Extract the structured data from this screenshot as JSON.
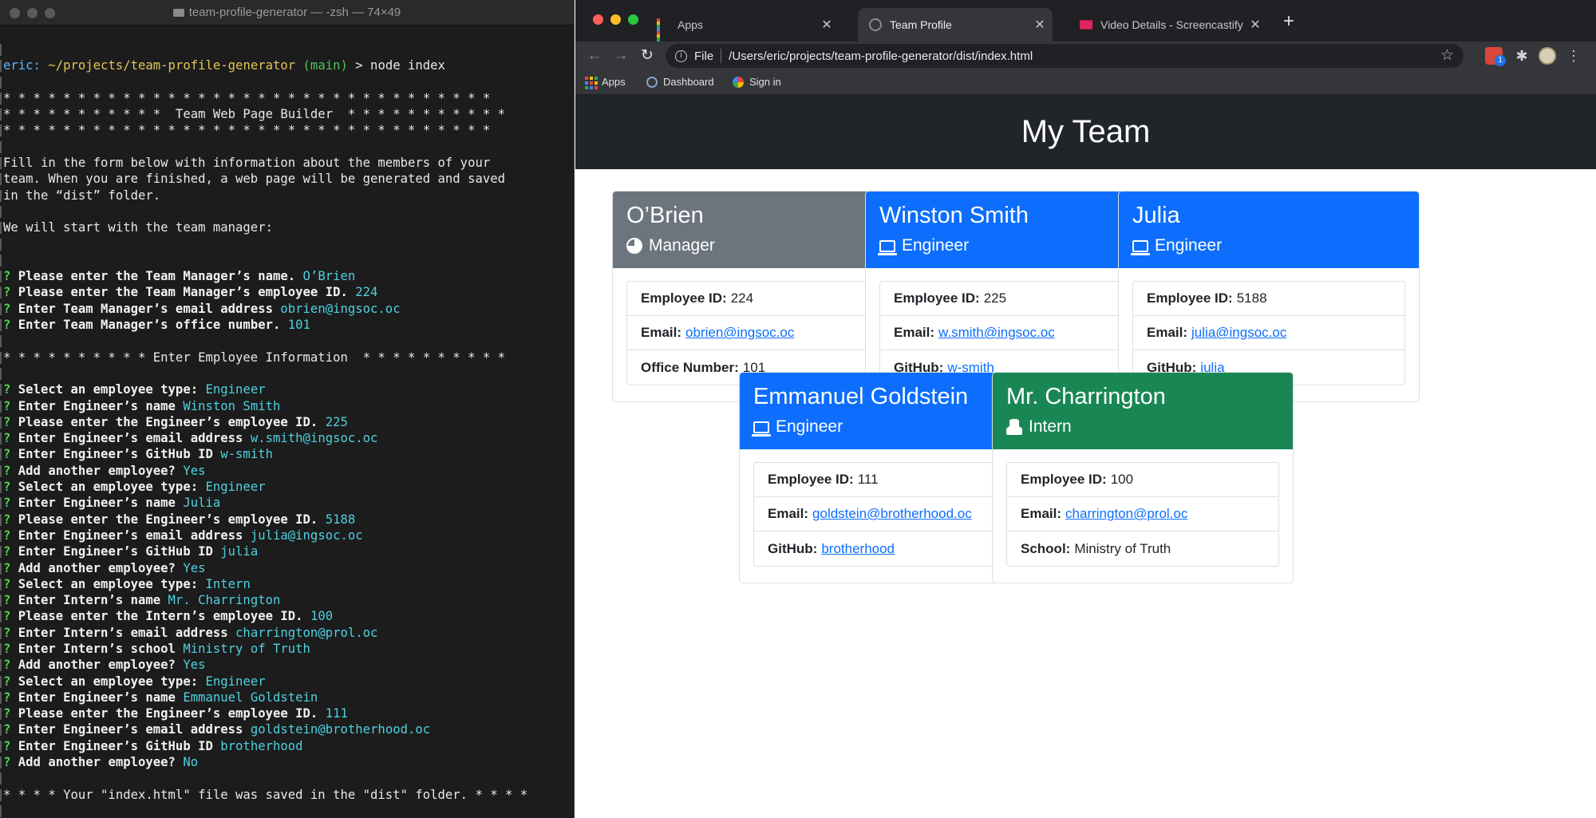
{
  "terminal": {
    "title": "team-profile-generator — -zsh — 74×49",
    "lines": [
      [],
      [
        {
          "t": "eric:",
          "c": "t-user"
        },
        {
          "t": " "
        },
        {
          "t": "~/projects/team-profile-generator",
          "c": "t-path"
        },
        {
          "t": " "
        },
        {
          "t": "(main)",
          "c": "t-branch"
        },
        {
          "t": " > node index"
        }
      ],
      [],
      [
        {
          "t": "* * * * * * * * * * * * * * * * * * * * * * * * * * * * * * * * *"
        }
      ],
      [
        {
          "t": "* * * * * * * * * * *  Team Web Page Builder  * * * * * * * * * * *"
        }
      ],
      [
        {
          "t": "* * * * * * * * * * * * * * * * * * * * * * * * * * * * * * * * *"
        }
      ],
      [],
      [
        {
          "t": "Fill in the form below with information about the members of your"
        }
      ],
      [
        {
          "t": "team. When you are finished, a web page will be generated and saved"
        }
      ],
      [
        {
          "t": "in the “dist” folder."
        }
      ],
      [],
      [
        {
          "t": "We will start with the team manager:"
        }
      ],
      [],
      [],
      [
        {
          "t": "? ",
          "c": "t-q"
        },
        {
          "t": "Please enter the Team Manager’s name. ",
          "c": "t-prompt"
        },
        {
          "t": "O’Brien",
          "c": "t-ans"
        }
      ],
      [
        {
          "t": "? ",
          "c": "t-q"
        },
        {
          "t": "Please enter the Team Manager’s employee ID. ",
          "c": "t-prompt"
        },
        {
          "t": "224",
          "c": "t-ans"
        }
      ],
      [
        {
          "t": "? ",
          "c": "t-q"
        },
        {
          "t": "Enter Team Manager’s email address ",
          "c": "t-prompt"
        },
        {
          "t": "obrien@ingsoc.oc",
          "c": "t-ans"
        }
      ],
      [
        {
          "t": "? ",
          "c": "t-q"
        },
        {
          "t": "Enter Team Manager’s office number. ",
          "c": "t-prompt"
        },
        {
          "t": "101",
          "c": "t-ans"
        }
      ],
      [],
      [
        {
          "t": "* * * * * * * * * * Enter Employee Information  * * * * * * * * * *"
        }
      ],
      [],
      [
        {
          "t": "? ",
          "c": "t-q"
        },
        {
          "t": "Select an employee type: ",
          "c": "t-prompt"
        },
        {
          "t": "Engineer",
          "c": "t-ans"
        }
      ],
      [
        {
          "t": "? ",
          "c": "t-q"
        },
        {
          "t": "Enter Engineer’s name ",
          "c": "t-prompt"
        },
        {
          "t": "Winston Smith",
          "c": "t-ans"
        }
      ],
      [
        {
          "t": "? ",
          "c": "t-q"
        },
        {
          "t": "Please enter the Engineer’s employee ID. ",
          "c": "t-prompt"
        },
        {
          "t": "225",
          "c": "t-ans"
        }
      ],
      [
        {
          "t": "? ",
          "c": "t-q"
        },
        {
          "t": "Enter Engineer’s email address ",
          "c": "t-prompt"
        },
        {
          "t": "w.smith@ingsoc.oc",
          "c": "t-ans"
        }
      ],
      [
        {
          "t": "? ",
          "c": "t-q"
        },
        {
          "t": "Enter Engineer’s GitHub ID ",
          "c": "t-prompt"
        },
        {
          "t": "w-smith",
          "c": "t-ans"
        }
      ],
      [
        {
          "t": "? ",
          "c": "t-q"
        },
        {
          "t": "Add another employee? ",
          "c": "t-prompt"
        },
        {
          "t": "Yes",
          "c": "t-ans"
        }
      ],
      [
        {
          "t": "? ",
          "c": "t-q"
        },
        {
          "t": "Select an employee type: ",
          "c": "t-prompt"
        },
        {
          "t": "Engineer",
          "c": "t-ans"
        }
      ],
      [
        {
          "t": "? ",
          "c": "t-q"
        },
        {
          "t": "Enter Engineer’s name ",
          "c": "t-prompt"
        },
        {
          "t": "Julia",
          "c": "t-ans"
        }
      ],
      [
        {
          "t": "? ",
          "c": "t-q"
        },
        {
          "t": "Please enter the Engineer’s employee ID. ",
          "c": "t-prompt"
        },
        {
          "t": "5188",
          "c": "t-ans"
        }
      ],
      [
        {
          "t": "? ",
          "c": "t-q"
        },
        {
          "t": "Enter Engineer’s email address ",
          "c": "t-prompt"
        },
        {
          "t": "julia@ingsoc.oc",
          "c": "t-ans"
        }
      ],
      [
        {
          "t": "? ",
          "c": "t-q"
        },
        {
          "t": "Enter Engineer’s GitHub ID ",
          "c": "t-prompt"
        },
        {
          "t": "julia",
          "c": "t-ans"
        }
      ],
      [
        {
          "t": "? ",
          "c": "t-q"
        },
        {
          "t": "Add another employee? ",
          "c": "t-prompt"
        },
        {
          "t": "Yes",
          "c": "t-ans"
        }
      ],
      [
        {
          "t": "? ",
          "c": "t-q"
        },
        {
          "t": "Select an employee type: ",
          "c": "t-prompt"
        },
        {
          "t": "Intern",
          "c": "t-ans"
        }
      ],
      [
        {
          "t": "? ",
          "c": "t-q"
        },
        {
          "t": "Enter Intern’s name ",
          "c": "t-prompt"
        },
        {
          "t": "Mr. Charrington",
          "c": "t-ans"
        }
      ],
      [
        {
          "t": "? ",
          "c": "t-q"
        },
        {
          "t": "Please enter the Intern’s employee ID. ",
          "c": "t-prompt"
        },
        {
          "t": "100",
          "c": "t-ans"
        }
      ],
      [
        {
          "t": "? ",
          "c": "t-q"
        },
        {
          "t": "Enter Intern’s email address ",
          "c": "t-prompt"
        },
        {
          "t": "charrington@prol.oc",
          "c": "t-ans"
        }
      ],
      [
        {
          "t": "? ",
          "c": "t-q"
        },
        {
          "t": "Enter Intern’s school ",
          "c": "t-prompt"
        },
        {
          "t": "Ministry of Truth",
          "c": "t-ans"
        }
      ],
      [
        {
          "t": "? ",
          "c": "t-q"
        },
        {
          "t": "Add another employee? ",
          "c": "t-prompt"
        },
        {
          "t": "Yes",
          "c": "t-ans"
        }
      ],
      [
        {
          "t": "? ",
          "c": "t-q"
        },
        {
          "t": "Select an employee type: ",
          "c": "t-prompt"
        },
        {
          "t": "Engineer",
          "c": "t-ans"
        }
      ],
      [
        {
          "t": "? ",
          "c": "t-q"
        },
        {
          "t": "Enter Engineer’s name ",
          "c": "t-prompt"
        },
        {
          "t": "Emmanuel Goldstein",
          "c": "t-ans"
        }
      ],
      [
        {
          "t": "? ",
          "c": "t-q"
        },
        {
          "t": "Please enter the Engineer’s employee ID. ",
          "c": "t-prompt"
        },
        {
          "t": "111",
          "c": "t-ans"
        }
      ],
      [
        {
          "t": "? ",
          "c": "t-q"
        },
        {
          "t": "Enter Engineer’s email address ",
          "c": "t-prompt"
        },
        {
          "t": "goldstein@brotherhood.oc",
          "c": "t-ans"
        }
      ],
      [
        {
          "t": "? ",
          "c": "t-q"
        },
        {
          "t": "Enter Engineer’s GitHub ID ",
          "c": "t-prompt"
        },
        {
          "t": "brotherhood",
          "c": "t-ans"
        }
      ],
      [
        {
          "t": "? ",
          "c": "t-q"
        },
        {
          "t": "Add another employee? ",
          "c": "t-prompt"
        },
        {
          "t": "No",
          "c": "t-ans"
        }
      ],
      [],
      [
        {
          "t": "* * * * Your \"index.html\" file was saved in the \"dist\" folder. * * * *"
        }
      ],
      [],
      [
        {
          "t": "eric:",
          "c": "t-user"
        },
        {
          "t": " "
        },
        {
          "t": "~/projects/team-profile-generator",
          "c": "t-path"
        },
        {
          "t": " "
        },
        {
          "t": "(main)",
          "c": "t-branch"
        },
        {
          "t": " > "
        },
        {
          "t": "",
          "c": "t-cursor"
        }
      ]
    ]
  },
  "browser": {
    "tabs": [
      {
        "label": "Apps",
        "icon": "apps-grid-icon",
        "active": false
      },
      {
        "label": "Team Profile",
        "icon": "globe-icon",
        "active": true
      },
      {
        "label": "Video Details - Screencastify",
        "icon": "screencastify-icon",
        "active": false
      }
    ],
    "omnibox": {
      "scheme": "File",
      "url": "/Users/eric/projects/team-profile-generator/dist/index.html"
    },
    "extension_badge": "1",
    "bookmarks": [
      {
        "label": "Apps",
        "icon": "apps-grid-icon"
      },
      {
        "label": "Dashboard",
        "icon": "dashboard-icon"
      },
      {
        "label": "Sign in",
        "icon": "google-icon"
      }
    ]
  },
  "page": {
    "heading": "My Team",
    "employees": [
      {
        "name": "O’Brien",
        "role": "Manager",
        "icon": "pie-chart-icon",
        "color": "#6c757d",
        "id_label": "Employee ID:",
        "id": "224",
        "email_label": "Email:",
        "email": "obrien@ingsoc.oc",
        "extra_label": "Office Number:",
        "extra": "101",
        "extra_is_link": false
      },
      {
        "name": "Winston Smith",
        "role": "Engineer",
        "icon": "laptop-code-icon",
        "color": "#0d6efd",
        "id_label": "Employee ID:",
        "id": "225",
        "email_label": "Email:",
        "email": "w.smith@ingsoc.oc",
        "extra_label": "GitHub:",
        "extra": "w-smith",
        "extra_is_link": true
      },
      {
        "name": "Julia",
        "role": "Engineer",
        "icon": "laptop-code-icon",
        "color": "#0d6efd",
        "id_label": "Employee ID:",
        "id": "5188",
        "email_label": "Email:",
        "email": "julia@ingsoc.oc",
        "extra_label": "GitHub:",
        "extra": "julia",
        "extra_is_link": true
      },
      {
        "name": "Emmanuel Goldstein",
        "role": "Engineer",
        "icon": "laptop-code-icon",
        "color": "#0d6efd",
        "id_label": "Employee ID:",
        "id": "111",
        "email_label": "Email:",
        "email": "goldstein@brotherhood.oc",
        "extra_label": "GitHub:",
        "extra": "brotherhood",
        "extra_is_link": true
      },
      {
        "name": "Mr. Charrington",
        "role": "Intern",
        "icon": "user-graduate-icon",
        "color": "#198754",
        "id_label": "Employee ID:",
        "id": "100",
        "email_label": "Email:",
        "email": "charrington@prol.oc",
        "extra_label": "School:",
        "extra": "Ministry of Truth",
        "extra_is_link": false
      }
    ]
  }
}
